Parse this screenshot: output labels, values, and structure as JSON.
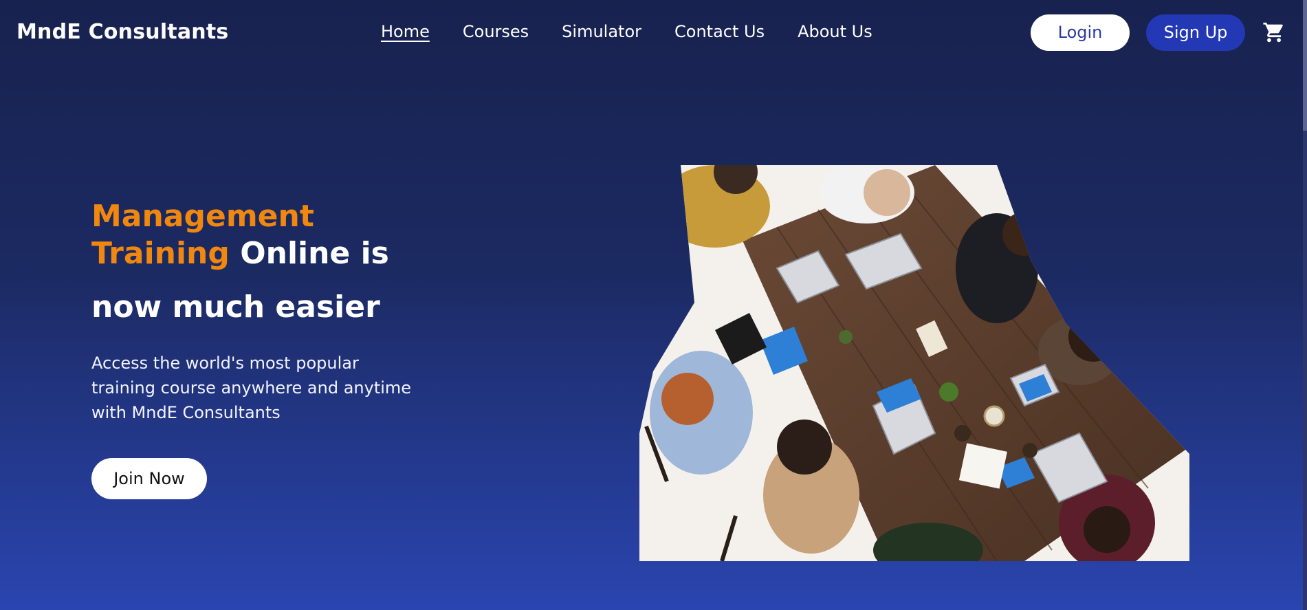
{
  "header": {
    "logo": "MndE Consultants",
    "nav": [
      {
        "label": "Home",
        "active": true
      },
      {
        "label": "Courses",
        "active": false
      },
      {
        "label": "Simulator",
        "active": false
      },
      {
        "label": "Contact Us",
        "active": false
      },
      {
        "label": "About Us",
        "active": false
      }
    ],
    "login_label": "Login",
    "signup_label": "Sign Up",
    "cart_icon": "shopping-cart-icon"
  },
  "hero": {
    "title_orange_1": "Management",
    "title_orange_2": "Training",
    "title_white_2": " Online is",
    "title_white_3": "now much easier",
    "description": "Access the world's most popular training course anywhere and anytime with MndE Consultants",
    "cta_label": "Join Now",
    "image_subject": "team-meeting-photo"
  },
  "colors": {
    "accent_orange": "#f0870f",
    "signup_blue": "#2238b4",
    "bg_top": "#18224f",
    "bg_bottom": "#2a45b0"
  }
}
